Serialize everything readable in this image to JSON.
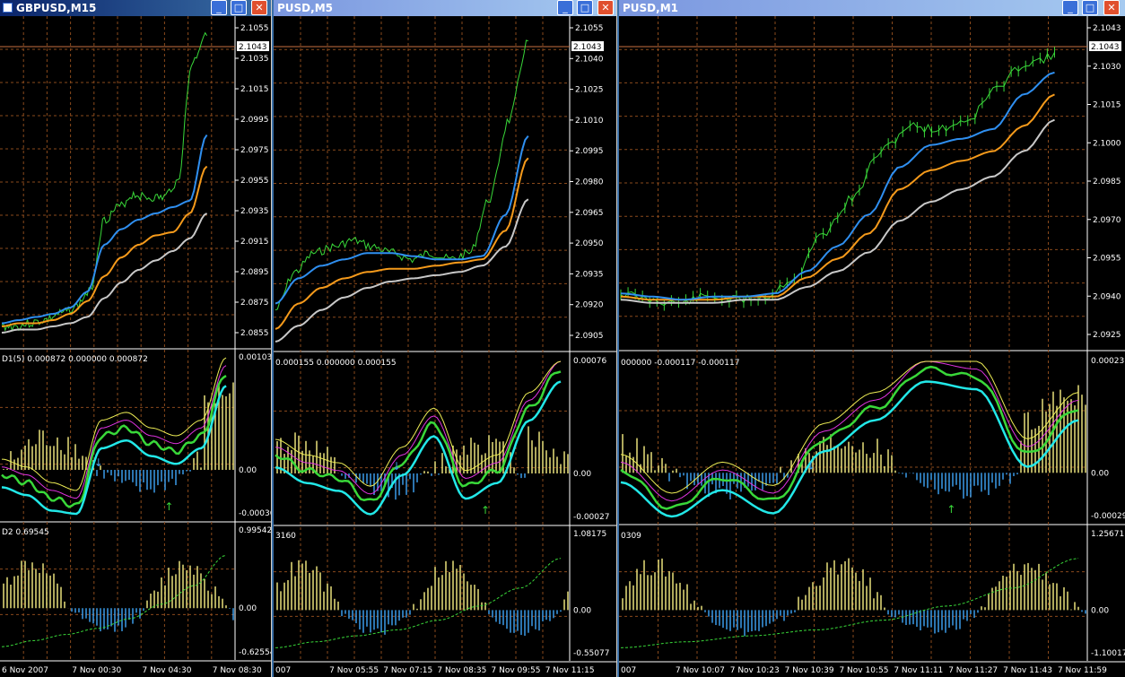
{
  "windows": [
    {
      "title": "GBPUSD,M15",
      "panel1_label": "",
      "panel2_label": "D1(5) 0.000872 0.000000 0.000872",
      "panel3_label": "D2 0.69545",
      "price_axis": [
        "2.1055",
        "2.1035",
        "2.1015",
        "2.0995",
        "2.0975",
        "2.0955",
        "2.0935",
        "2.0915",
        "2.0895",
        "2.0875",
        "2.0855"
      ],
      "osc1_axis": [
        "0.001034",
        "0.00",
        "-0.00036"
      ],
      "osc2_axis": [
        "0.99542",
        "0.00",
        "-0.62554"
      ],
      "time_axis": [
        "6 Nov 2007",
        "7 Nov 00:30",
        "7 Nov 04:30",
        "7 Nov 08:30"
      ],
      "price_tag": "2.1043",
      "buttons": {
        "minimize": "_",
        "maximize": "□",
        "close": "✕"
      }
    },
    {
      "title": "PUSD,M5",
      "panel1_label": "",
      "panel2_label": "0.000155 0.000000 0.000155",
      "panel3_label": "3160",
      "price_axis": [
        "2.1055",
        "2.1040",
        "2.1025",
        "2.1010",
        "2.0995",
        "2.0980",
        "2.0965",
        "2.0950",
        "2.0935",
        "2.0920",
        "2.0905"
      ],
      "osc1_axis": [
        "0.00076",
        "0.00",
        "-0.00027"
      ],
      "osc2_axis": [
        "1.08175",
        "0.00",
        "-0.55077"
      ],
      "time_axis": [
        "007",
        "7 Nov 05:55",
        "7 Nov 07:15",
        "7 Nov 08:35",
        "7 Nov 09:55",
        "7 Nov 11:15"
      ],
      "price_tag": "2.1043",
      "buttons": {
        "minimize": "_",
        "maximize": "□",
        "close": "✕"
      }
    },
    {
      "title": "PUSD,M1",
      "panel1_label": "",
      "panel2_label": "000000 -0.000117 -0.000117",
      "panel3_label": "0309",
      "price_axis": [
        "2.1043",
        "2.1030",
        "2.1015",
        "2.1000",
        "2.0985",
        "2.0970",
        "2.0955",
        "2.0940",
        "2.0925"
      ],
      "osc1_axis": [
        "0.00023",
        "0.00",
        "-0.00029"
      ],
      "osc2_axis": [
        "1.25671",
        "0.00",
        "-1.10017"
      ],
      "time_axis": [
        "007",
        "7 Nov 10:07",
        "7 Nov 10:23",
        "7 Nov 10:39",
        "7 Nov 10:55",
        "7 Nov 11:11",
        "7 Nov 11:27",
        "7 Nov 11:43",
        "7 Nov 11:59"
      ],
      "price_tag": "2.1043",
      "buttons": {
        "minimize": "_",
        "maximize": "□",
        "close": "✕"
      }
    }
  ],
  "colors": {
    "price_line": "#39d839",
    "ma_fast": "#2f8ff0",
    "ma_mid": "#f59a1b",
    "ma_slow": "#c8c8c8",
    "hist_pos": "#e8e07a",
    "hist_neg": "#3a9be8",
    "grid": "#8a4a1c",
    "cyan": "#22e8e8",
    "magenta": "#e033e0",
    "yellow_line": "#eeee55"
  }
}
